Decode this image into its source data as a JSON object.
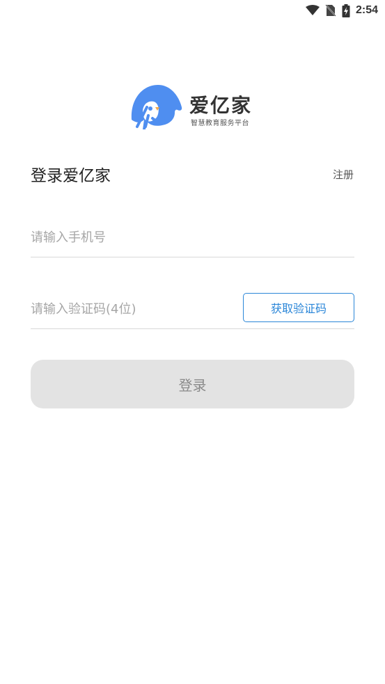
{
  "status_bar": {
    "time": "2:54",
    "icons": [
      "wifi-icon",
      "no-sim-icon",
      "battery-charging-icon"
    ]
  },
  "brand": {
    "name": "爱亿家",
    "slogan": "智慧教育服务平台",
    "colors": {
      "logo_blue": "#4f8ef0",
      "logo_orange": "#f4a84a"
    }
  },
  "login": {
    "title": "登录爱亿家",
    "register_label": "注册",
    "phone_placeholder": "请输入手机号",
    "phone_value": "",
    "code_placeholder": "请输入验证码(4位)",
    "code_value": "",
    "get_code_label": "获取验证码",
    "submit_label": "登录"
  },
  "colors": {
    "accent": "#2a86d8",
    "button_disabled_bg": "#e3e3e3",
    "button_disabled_text": "#8a8a8a"
  }
}
